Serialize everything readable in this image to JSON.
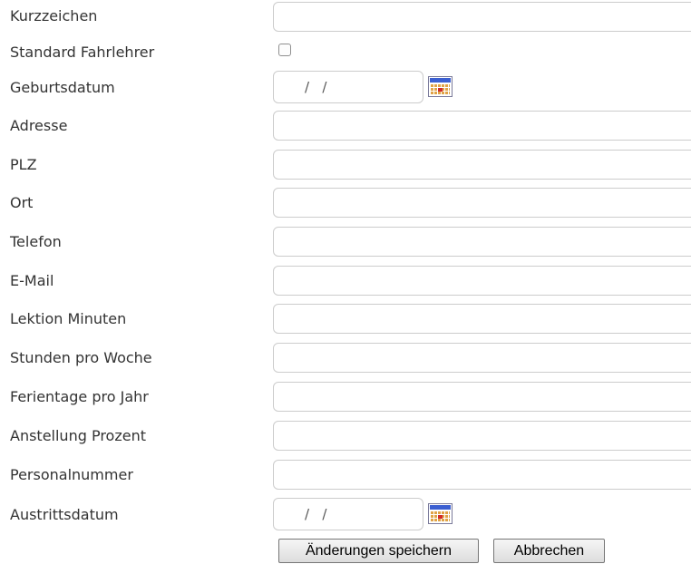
{
  "form": {
    "fields": {
      "kurzzeichen": {
        "label": "Kurzzeichen",
        "value": ""
      },
      "standard_fahrlehrer": {
        "label": "Standard Fahrlehrer",
        "checked": false
      },
      "geburtsdatum": {
        "label": "Geburtsdatum",
        "value": "/   /"
      },
      "adresse": {
        "label": "Adresse",
        "value": ""
      },
      "plz": {
        "label": "PLZ",
        "value": ""
      },
      "ort": {
        "label": "Ort",
        "value": ""
      },
      "telefon": {
        "label": "Telefon",
        "value": ""
      },
      "email": {
        "label": "E-Mail",
        "value": ""
      },
      "lektion_minuten": {
        "label": "Lektion Minuten",
        "value": ""
      },
      "stunden_pro_woche": {
        "label": "Stunden pro Woche",
        "value": ""
      },
      "ferientage_pro_jahr": {
        "label": "Ferientage pro Jahr",
        "value": ""
      },
      "anstellung_prozent": {
        "label": "Anstellung Prozent",
        "value": ""
      },
      "personalnummer": {
        "label": "Personalnummer",
        "value": ""
      },
      "austrittsdatum": {
        "label": "Austrittsdatum",
        "value": "/   /"
      }
    },
    "buttons": {
      "save_label": "Änderungen speichern",
      "cancel_label": "Abbrechen"
    }
  },
  "icons": {
    "date_picker": "calendar-icon"
  },
  "colors": {
    "label_text": "#333333",
    "input_border": "#cccccc",
    "calendar_header": "#3b5fd1",
    "calendar_body": "#e0a346"
  }
}
